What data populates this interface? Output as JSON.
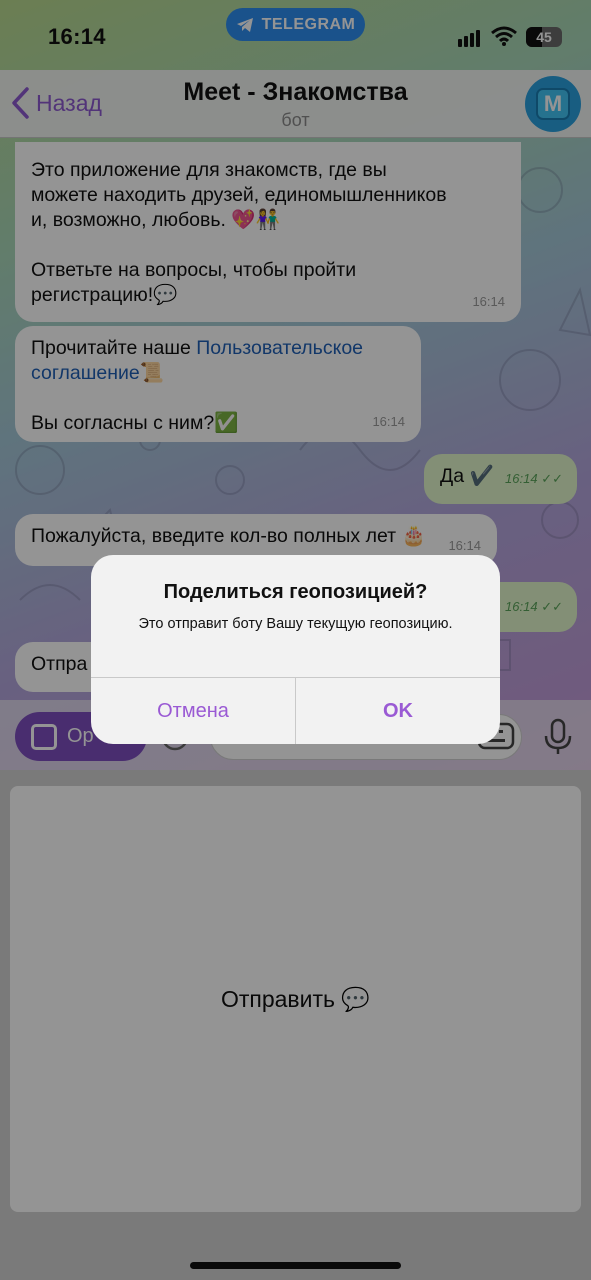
{
  "status_bar": {
    "time": "16:14",
    "app_pill": "TELEGRAM",
    "battery": "45"
  },
  "nav": {
    "back_label": "Назад",
    "title": "Meet - Знакомства",
    "subtitle": "бот",
    "avatar_letter": "M"
  },
  "messages": [
    {
      "text_lines": [
        "Это приложение для знакомств, где вы",
        "можете находить друзей, единомышленников",
        "и, возможно, любовь. 💖👫",
        "",
        "Ответьте на вопросы, чтобы пройти",
        "регистрацию!💬"
      ],
      "time": "16:14",
      "direction": "in"
    },
    {
      "text_pre": "Прочитайте наше ",
      "link": "Пользовательское",
      "link2": "соглашение",
      "emoji": "📜",
      "text_line2": "Вы согласны с ним?✅",
      "time": "16:14",
      "direction": "in"
    },
    {
      "text": "Да ✔️",
      "time": "16:14",
      "direction": "out"
    },
    {
      "text": "Пожалуйста, введите кол-во полных лет 🎂",
      "time": "16:14",
      "direction": "in"
    },
    {
      "text": "",
      "time": "16:14",
      "direction": "out"
    },
    {
      "text": "Отпра",
      "direction": "in"
    }
  ],
  "input": {
    "menu_label": "Ор"
  },
  "keyboard": {
    "button_label": "Отправить 💬"
  },
  "alert": {
    "title": "Поделиться геопозицией?",
    "message": "Это отправит боту Вашу текущую геопозицию.",
    "cancel_label": "Отмена",
    "ok_label": "OK"
  },
  "colors": {
    "accent": "#9a5ad4",
    "telegram_blue": "#2d8df0",
    "link": "#1f5fb5"
  }
}
